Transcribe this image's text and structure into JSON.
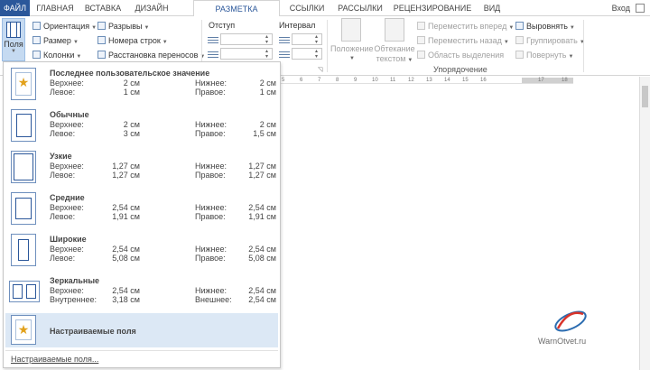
{
  "tabs": [
    {
      "label": "ФАЙЛ"
    },
    {
      "label": "ГЛАВНАЯ"
    },
    {
      "label": "ВСТАВКА"
    },
    {
      "label": "ДИЗАЙН"
    },
    {
      "label": "РАЗМЕТКА СТРАНИЦЫ"
    },
    {
      "label": "ССЫЛКИ"
    },
    {
      "label": "РАССЫЛКИ"
    },
    {
      "label": "РЕЦЕНЗИРОВАНИЕ"
    },
    {
      "label": "ВИД"
    }
  ],
  "login_label": "Вход",
  "ribbon": {
    "margins_label": "Поля",
    "orientation_label": "Ориентация",
    "size_label": "Размер",
    "columns_label": "Колонки",
    "breaks_label": "Разрывы",
    "line_numbers_label": "Номера строк",
    "hyphenation_label": "Расстановка переносов",
    "indent_label": "Отступ",
    "spacing_label": "Интервал",
    "position_label_1": "Положение",
    "wrap_label_1": "Обтекание",
    "wrap_label_2": "текстом",
    "bring_forward_label": "Переместить вперед",
    "send_backward_label": "Переместить назад",
    "selection_pane_label": "Область выделения",
    "align_label": "Выровнять",
    "group_label": "Группировать",
    "rotate_label": "Повернуть",
    "arrange_group_label": "Упорядочение"
  },
  "ruler_numbers": [
    "5",
    "6",
    "7",
    "8",
    "9",
    "10",
    "11",
    "12",
    "13",
    "14",
    "15",
    "16",
    "17",
    "18"
  ],
  "margins": [
    {
      "name": "Последнее пользовательское значение",
      "l1": "Верхнее:",
      "v1": "2 см",
      "l2": "Нижнее:",
      "v2": "2 см",
      "l3": "Левое:",
      "v3": "1 см",
      "l4": "Правое:",
      "v4": "1 см"
    },
    {
      "name": "Обычные",
      "l1": "Верхнее:",
      "v1": "2 см",
      "l2": "Нижнее:",
      "v2": "2 см",
      "l3": "Левое:",
      "v3": "3 см",
      "l4": "Правое:",
      "v4": "1,5 см"
    },
    {
      "name": "Узкие",
      "l1": "Верхнее:",
      "v1": "1,27 см",
      "l2": "Нижнее:",
      "v2": "1,27 см",
      "l3": "Левое:",
      "v3": "1,27 см",
      "l4": "Правое:",
      "v4": "1,27 см"
    },
    {
      "name": "Средние",
      "l1": "Верхнее:",
      "v1": "2,54 см",
      "l2": "Нижнее:",
      "v2": "2,54 см",
      "l3": "Левое:",
      "v3": "1,91 см",
      "l4": "Правое:",
      "v4": "1,91 см"
    },
    {
      "name": "Широкие",
      "l1": "Верхнее:",
      "v1": "2,54 см",
      "l2": "Нижнее:",
      "v2": "2,54 см",
      "l3": "Левое:",
      "v3": "5,08 см",
      "l4": "Правое:",
      "v4": "5,08 см"
    },
    {
      "name": "Зеркальные",
      "l1": "Верхнее:",
      "v1": "2,54 см",
      "l2": "Нижнее:",
      "v2": "2,54 см",
      "l3": "Внутреннее:",
      "v3": "3,18 см",
      "l4": "Внешнее:",
      "v4": "2,54 см"
    }
  ],
  "custom_margins_item": "Настраиваемые поля",
  "custom_margins_footer": "Настраиваемые поля...",
  "watermark_text": "WarnOtvet.ru",
  "colors": {
    "file_tab": "#2b579a",
    "accent": "#2b579a",
    "selected_bg": "#dce8f5",
    "star": "#e2a11b"
  },
  "icons": [
    "star-icon",
    "margins-icon",
    "orientation-icon",
    "size-icon",
    "columns-icon",
    "breaks-icon",
    "line-numbers-icon",
    "hyphenation-icon",
    "indent-left-icon",
    "indent-right-icon",
    "spacing-before-icon",
    "spacing-after-icon",
    "position-icon",
    "wrap-text-icon",
    "bring-forward-icon",
    "send-backward-icon",
    "selection-pane-icon",
    "align-icon",
    "group-icon",
    "rotate-icon"
  ]
}
